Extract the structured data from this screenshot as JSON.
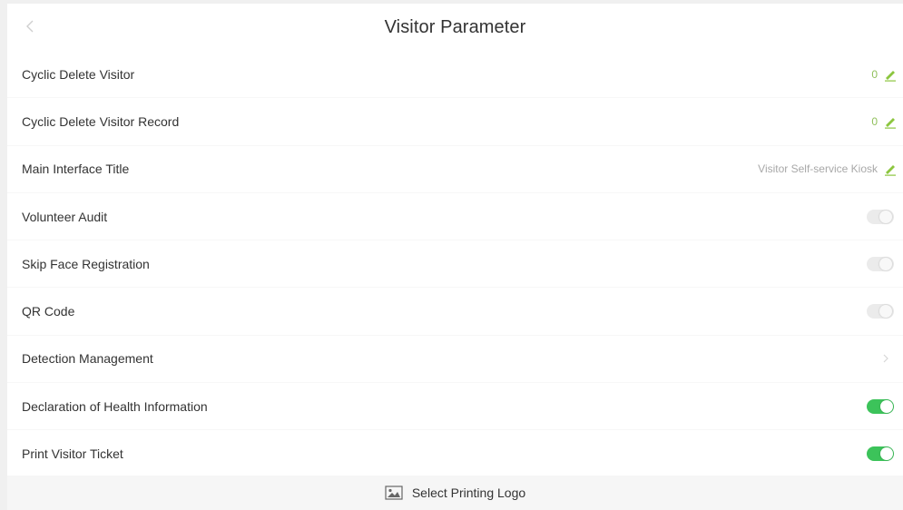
{
  "header": {
    "title": "Visitor Parameter",
    "back_icon": "chevron-left-icon"
  },
  "rows": [
    {
      "label": "Cyclic Delete Visitor",
      "type": "edit",
      "value": "0",
      "value_color": "#8fbf5a",
      "icon": "pencil-icon"
    },
    {
      "label": "Cyclic Delete Visitor Record",
      "type": "edit",
      "value": "0",
      "value_color": "#8fbf5a",
      "icon": "pencil-icon"
    },
    {
      "label": "Main Interface Title",
      "type": "edit",
      "value": "Visitor Self-service Kiosk",
      "value_color": "#a8a8a8",
      "icon": "pencil-icon"
    },
    {
      "label": "Volunteer Audit",
      "type": "toggle",
      "enabled": false
    },
    {
      "label": "Skip Face Registration",
      "type": "toggle",
      "enabled": false
    },
    {
      "label": "QR Code",
      "type": "toggle",
      "enabled": false
    },
    {
      "label": "Detection Management",
      "type": "link",
      "icon": "chevron-right-icon"
    },
    {
      "label": "Declaration of Health Information",
      "type": "toggle",
      "enabled": true
    },
    {
      "label": "Print Visitor Ticket",
      "type": "toggle",
      "enabled": true
    }
  ],
  "footer": {
    "label": "Select Printing Logo",
    "icon": "image-icon"
  },
  "colors": {
    "accent_green": "#3cc35a",
    "edit_icon": "#8cc63f",
    "toggle_off": "#ebebeb"
  }
}
